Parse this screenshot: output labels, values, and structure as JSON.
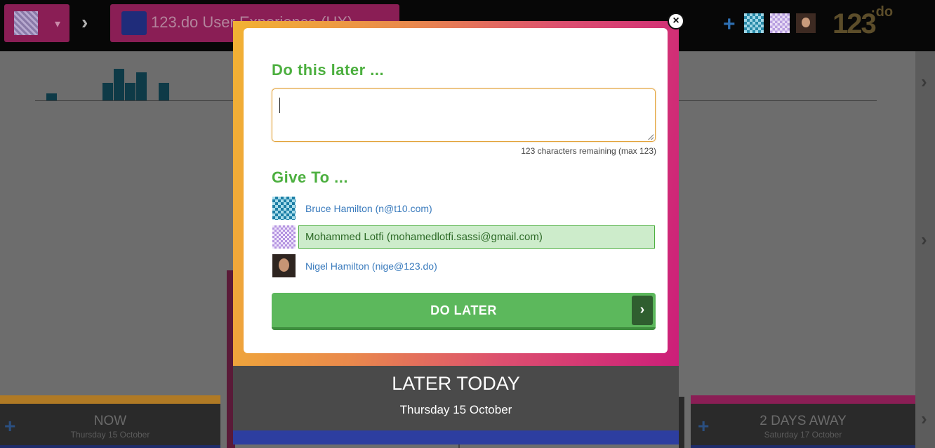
{
  "header": {
    "project_title": "123.do User Experience (UX)",
    "logo_text": "123",
    "logo_suffix": "·do"
  },
  "icons": {
    "board_caret": "▾",
    "breadcrumb_chevron": "›",
    "add_member": "+",
    "close": "×",
    "right_chevron": "›",
    "column_add": "+",
    "button_arrow": "›"
  },
  "modal": {
    "title": "Do this later ...",
    "input_value": "",
    "chars_remaining": "123 characters remaining (max 123)",
    "give_to_title": "Give To ...",
    "people": [
      {
        "name": "Bruce Hamilton (n@t10.com)",
        "selected": false
      },
      {
        "name": "Mohammed Lotfi (mohamedlotfi.sassi@gmail.com)",
        "selected": true
      },
      {
        "name": "Nigel Hamilton (nige@123.do)",
        "selected": false
      }
    ],
    "button_label": "DO LATER"
  },
  "later_today": {
    "title": "LATER TODAY",
    "date": "Thursday 15 October"
  },
  "columns": [
    {
      "title": "NOW",
      "date": "Thursday 15 October"
    },
    {
      "title": "2 DAYS AWAY",
      "date": "Saturday 17 October"
    }
  ],
  "colors": {
    "accent_green": "#4caf3f",
    "button_green": "#5cb85c",
    "selected_row": "#cdeccb",
    "link_blue": "#3a7bbd",
    "frame_gradient_start": "#f2b233",
    "frame_gradient_end": "#cc1e79",
    "board_magenta": "#8a1e55"
  }
}
